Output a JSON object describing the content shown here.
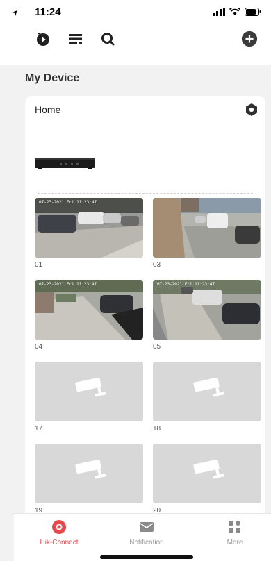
{
  "status_bar": {
    "time": "11:24"
  },
  "header": {
    "title": "My Device"
  },
  "device_card": {
    "name": "Home",
    "cameras": [
      {
        "label": "01",
        "timestamp": "07-23-2021 Fri 11:23:47",
        "has_video": true
      },
      {
        "label": "03",
        "timestamp": "",
        "has_video": true
      },
      {
        "label": "04",
        "timestamp": "07-23-2021 Fri 11:23:47",
        "has_video": true
      },
      {
        "label": "05",
        "timestamp": "07-23-2021 Fri 11:23:47",
        "has_video": true
      },
      {
        "label": "17",
        "timestamp": "",
        "has_video": false
      },
      {
        "label": "18",
        "timestamp": "",
        "has_video": false
      },
      {
        "label": "19",
        "timestamp": "",
        "has_video": false
      },
      {
        "label": "20",
        "timestamp": "",
        "has_video": false
      }
    ]
  },
  "tabbar": {
    "tabs": [
      {
        "label": "Hik-Connect",
        "icon": "record-icon",
        "active": true
      },
      {
        "label": "Notification",
        "icon": "envelope-icon",
        "active": false
      },
      {
        "label": "More",
        "icon": "grid-icon",
        "active": false
      }
    ]
  },
  "colors": {
    "accent": "#e5484d",
    "placeholder": "#d8d8d8",
    "background": "#f2f2f2"
  }
}
